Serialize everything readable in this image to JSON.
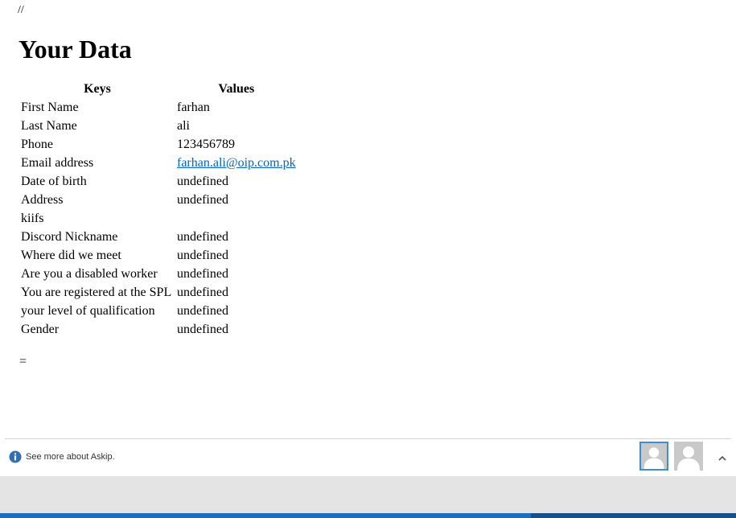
{
  "top_comment": "//",
  "page_title": "Your Data",
  "table": {
    "headers": {
      "keys": "Keys",
      "values": "Values"
    },
    "rows": [
      {
        "key": "First Name",
        "value": "farhan"
      },
      {
        "key": "Last Name",
        "value": "ali"
      },
      {
        "key": "Phone",
        "value": "123456789"
      },
      {
        "key": "Email address",
        "value": "farhan.ali@oip.com.pk",
        "is_link": true
      },
      {
        "key": "Date of birth",
        "value": "undefined"
      },
      {
        "key": "Address",
        "value": "undefined"
      },
      {
        "key": "kiifs",
        "value": ""
      },
      {
        "key": "Discord Nickname",
        "value": "undefined"
      },
      {
        "key": "Where did we meet",
        "value": "undefined"
      },
      {
        "key": "Are you a disabled worker",
        "value": "undefined"
      },
      {
        "key": "You are registered at the SPL",
        "value": "undefined"
      },
      {
        "key": "your level of qualification",
        "value": "undefined"
      },
      {
        "key": "Gender",
        "value": "undefined"
      }
    ]
  },
  "trailing_text": "=",
  "footer": {
    "info_icon": "info-icon",
    "info_text": "See more about Askip.",
    "avatars": [
      "person-avatar-icon",
      "person-avatar-icon"
    ],
    "expand_icon": "chevron-up-icon",
    "accent_color": "#3b8ed8",
    "link_color": "#0563c1"
  }
}
